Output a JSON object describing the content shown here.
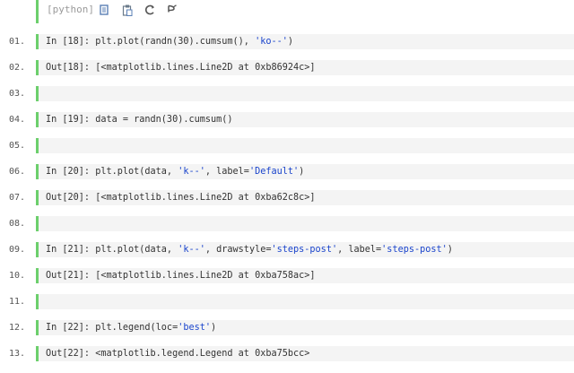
{
  "toolbar": {
    "language_label": "[python]",
    "icons": [
      "copy-icon",
      "paste-icon",
      "refresh-icon",
      "brush-icon"
    ]
  },
  "lines": [
    {
      "no": "01.",
      "parts": [
        {
          "t": "In [18]: plt.plot(randn(30).cumsum(), "
        },
        {
          "t": "'ko--'",
          "s": true
        },
        {
          "t": ")"
        }
      ]
    },
    {
      "no": "02.",
      "parts": [
        {
          "t": "Out[18]: [<matplotlib.lines.Line2D at 0xb86924c>]"
        }
      ]
    },
    {
      "no": "03.",
      "parts": []
    },
    {
      "no": "04.",
      "parts": [
        {
          "t": "In [19]: data = randn(30).cumsum()"
        }
      ]
    },
    {
      "no": "05.",
      "parts": []
    },
    {
      "no": "06.",
      "parts": [
        {
          "t": "In [20]: plt.plot(data, "
        },
        {
          "t": "'k--'",
          "s": true
        },
        {
          "t": ", label="
        },
        {
          "t": "'Default'",
          "s": true
        },
        {
          "t": ")"
        }
      ]
    },
    {
      "no": "07.",
      "parts": [
        {
          "t": "Out[20]: [<matplotlib.lines.Line2D at 0xba62c8c>]"
        }
      ]
    },
    {
      "no": "08.",
      "parts": []
    },
    {
      "no": "09.",
      "parts": [
        {
          "t": "In [21]: plt.plot(data, "
        },
        {
          "t": "'k--'",
          "s": true
        },
        {
          "t": ", drawstyle="
        },
        {
          "t": "'steps-post'",
          "s": true
        },
        {
          "t": ", label="
        },
        {
          "t": "'steps-post'",
          "s": true
        },
        {
          "t": ")"
        }
      ]
    },
    {
      "no": "10.",
      "parts": [
        {
          "t": "Out[21]: [<matplotlib.lines.Line2D at 0xba758ac>]"
        }
      ]
    },
    {
      "no": "11.",
      "parts": []
    },
    {
      "no": "12.",
      "parts": [
        {
          "t": "In [22]: plt.legend(loc="
        },
        {
          "t": "'best'",
          "s": true
        },
        {
          "t": ")"
        }
      ]
    },
    {
      "no": "13.",
      "parts": [
        {
          "t": "Out[22]: <matplotlib.legend.Legend at 0xba75bcc>"
        }
      ]
    }
  ],
  "colors": {
    "gutter_accent": "#6ccf6c",
    "code_background": "#f4f4f4",
    "string_literal": "#1a44cc",
    "code_text": "#333333"
  }
}
